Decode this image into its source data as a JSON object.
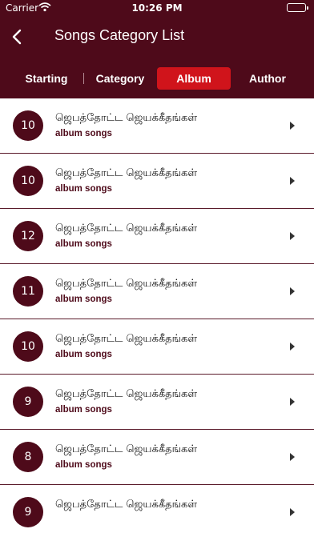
{
  "status_bar": {
    "carrier": "Carrier",
    "time": "10:26 PM"
  },
  "nav": {
    "title": "Songs Category List"
  },
  "tabs": [
    {
      "label": "Starting"
    },
    {
      "label": "Category"
    },
    {
      "label": "Album"
    },
    {
      "label": "Author"
    }
  ],
  "active_tab": "Album",
  "colors": {
    "primary": "#4e0a1a",
    "accent": "#d0141b"
  },
  "songs": [
    {
      "count": "10",
      "title": "ஜெபத்தோட்ட ஜெயக்கீதங்கள்",
      "subtitle": "album songs"
    },
    {
      "count": "10",
      "title": "ஜெபத்தோட்ட ஜெயக்கீதங்கள்",
      "subtitle": "album songs"
    },
    {
      "count": "12",
      "title": "ஜெபத்தோட்ட ஜெயக்கீதங்கள்",
      "subtitle": "album songs"
    },
    {
      "count": "11",
      "title": "ஜெபத்தோட்ட ஜெயக்கீதங்கள்",
      "subtitle": "album songs"
    },
    {
      "count": "10",
      "title": "ஜெபத்தோட்ட ஜெயக்கீதங்கள்",
      "subtitle": "album songs"
    },
    {
      "count": "9",
      "title": "ஜெபத்தோட்ட ஜெயக்கீதங்கள்",
      "subtitle": "album songs"
    },
    {
      "count": "8",
      "title": "ஜெபத்தோட்ட ஜெயக்கீதங்கள்",
      "subtitle": "album songs"
    },
    {
      "count": "9",
      "title": "ஜெபத்தோட்ட ஜெயக்கீதங்கள்",
      "subtitle": ""
    }
  ]
}
